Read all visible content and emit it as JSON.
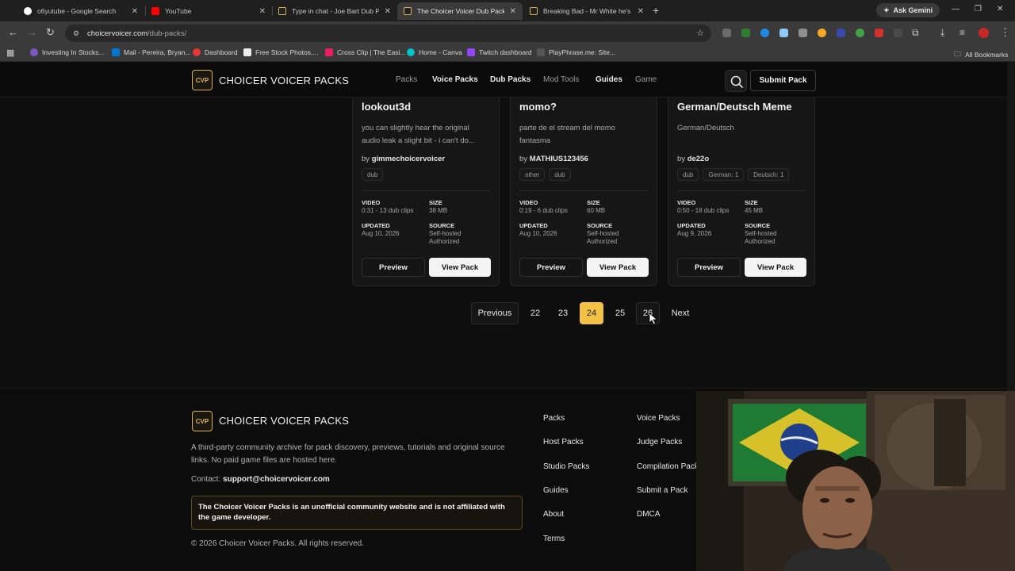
{
  "browser": {
    "tabs": [
      {
        "title": "o6yutube - Google Search",
        "icon": "google-icon",
        "color": "#4285f4"
      },
      {
        "title": "YouTube",
        "icon": "youtube-icon",
        "color": "#ff0000"
      },
      {
        "title": "Type in chat - Joe Bart Dub Pa",
        "icon": "site-icon",
        "color": "#d9b25a"
      },
      {
        "title": "The Choicer Voicer Dub Packs |",
        "icon": "site-icon",
        "color": "#d9b25a"
      },
      {
        "title": "Breaking Bad - Mr White he's t",
        "icon": "site-icon",
        "color": "#d9b25a"
      }
    ],
    "ask_gemini": "Ask Gemini",
    "url_host": "choicervoicer.com",
    "url_path": "/dub-packs/",
    "bookmarks": [
      {
        "label": "Investing In Stocks...",
        "color": "#7e57c2"
      },
      {
        "label": "Mail - Pereira, Bryan...",
        "color": "#0078d4"
      },
      {
        "label": "Dashboard",
        "color": "#e53935"
      },
      {
        "label": "Free Stock Photos,...",
        "color": "#eeeeee"
      },
      {
        "label": "Cross Clip | The Easi...",
        "color": "#e91e63"
      },
      {
        "label": "Home - Canva",
        "color": "#00c4cc"
      },
      {
        "label": "Twitch dashboard",
        "color": "#9146ff"
      },
      {
        "label": "PlayPhrase.me: Site...",
        "color": "#555555"
      }
    ],
    "all_bookmarks": "All Bookmarks"
  },
  "site": {
    "logo": "CVP",
    "brand": "CHOICER VOICER PACKS",
    "nav": [
      "Packs",
      "Voice Packs",
      "Dub Packs",
      "Mod Tools",
      "Guides",
      "Game"
    ],
    "submit": "Submit Pack"
  },
  "cards": [
    {
      "title": "lookout3d",
      "desc": "you can slightly hear the original audio leak a slight bit - i can't do...",
      "by_prefix": "by",
      "author": "gimmechoicervoicer",
      "tags": [
        "dub"
      ],
      "video_label": "VIDEO",
      "video": "0:31 - 13 dub clips",
      "size_label": "SIZE",
      "size": "38 MB",
      "updated_label": "UPDATED",
      "updated": "Aug 10, 2026",
      "source_label": "SOURCE",
      "source1": "Self-hosted",
      "source2": "Authorized",
      "preview": "Preview",
      "view": "View Pack"
    },
    {
      "title": "momo?",
      "desc": "parte de el stream del momo fantasma",
      "by_prefix": "by",
      "author": "MATHIUS123456",
      "tags": [
        "other",
        "dub"
      ],
      "video_label": "VIDEO",
      "video": "0:19 - 6 dub clips",
      "size_label": "SIZE",
      "size": "60 MB",
      "updated_label": "UPDATED",
      "updated": "Aug 10, 2026",
      "source_label": "SOURCE",
      "source1": "Self-hosted",
      "source2": "Authorized",
      "preview": "Preview",
      "view": "View Pack"
    },
    {
      "title": "German/Deutsch Meme",
      "desc": "German/Deutsch",
      "by_prefix": "by",
      "author": "de22o",
      "tags": [
        "dub",
        "German: 1",
        "Deutsch: 1"
      ],
      "video_label": "VIDEO",
      "video": "0:50 - 18 dub clips",
      "size_label": "SIZE",
      "size": "45 MB",
      "updated_label": "UPDATED",
      "updated": "Aug 9, 2026",
      "source_label": "SOURCE",
      "source1": "Self-hosted",
      "source2": "Authorized",
      "preview": "Preview",
      "view": "View Pack"
    }
  ],
  "pagination": {
    "previous": "Previous",
    "pages": [
      "22",
      "23",
      "24",
      "25",
      "26"
    ],
    "current": "24",
    "next": "Next"
  },
  "footer": {
    "logo": "CVP",
    "brand": "CHOICER VOICER PACKS",
    "about": "A third-party community archive for pack discovery, previews, tutorials and original source links. No paid game files are hosted here.",
    "contact_label": "Contact:",
    "contact_email": "support@choicervoicer.com",
    "disclaimer": "The Choicer Voicer Packs is an unofficial community website and is not affiliated with the game developer.",
    "copyright": "© 2026 Choicer Voicer Packs. All rights reserved.",
    "links_col1": [
      "Packs",
      "Host Packs",
      "Studio Packs",
      "Guides",
      "About",
      "Terms"
    ],
    "links_col2": [
      "Voice Packs",
      "Judge Packs",
      "Compilation Packs",
      "Submit a Pack",
      "DMCA"
    ]
  },
  "colors": {
    "accent": "#f3c245",
    "logo_gold": "#d9b25a"
  }
}
